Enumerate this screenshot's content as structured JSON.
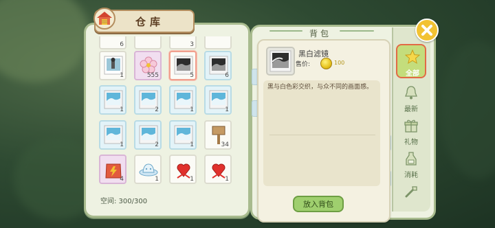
{
  "warehouse": {
    "title": "仓库",
    "capacity_text": "空间: 300/300",
    "slots": [
      {
        "item": "card-top",
        "count": "6",
        "style": "white"
      },
      {
        "item": "card-top",
        "count": "",
        "style": "white"
      },
      {
        "item": "card-top",
        "count": "3",
        "style": "white"
      },
      {
        "item": "card-top",
        "count": "",
        "style": "white"
      },
      {
        "item": "postcard-figure",
        "count": "1",
        "style": "white"
      },
      {
        "item": "cherry-blossom",
        "count": "555",
        "style": "purple"
      },
      {
        "item": "photo-bw",
        "count": "5",
        "style": "white",
        "selected": true
      },
      {
        "item": "photo-bw",
        "count": "6",
        "style": "blue"
      },
      {
        "item": "photo-sky",
        "count": "1",
        "style": "blue"
      },
      {
        "item": "photo-sky",
        "count": "2",
        "style": "blue"
      },
      {
        "item": "photo-sky",
        "count": "1",
        "style": "blue"
      },
      {
        "item": "photo-sky",
        "count": "1",
        "style": "blue"
      },
      {
        "item": "photo-sky",
        "count": "1",
        "style": "blue"
      },
      {
        "item": "photo-sky",
        "count": "2",
        "style": "blue"
      },
      {
        "item": "photo-sky",
        "count": "1",
        "style": "blue"
      },
      {
        "item": "wooden-sign",
        "count": "34",
        "style": "white"
      },
      {
        "item": "red-bag",
        "count": "4",
        "style": "purple"
      },
      {
        "item": "blue-hat",
        "count": "1",
        "style": "white"
      },
      {
        "item": "heart-bow",
        "count": "1",
        "style": "white"
      },
      {
        "item": "heart-bow",
        "count": "1",
        "style": "white"
      }
    ]
  },
  "bag": {
    "title": "背包",
    "item_name": "黑白滤镜",
    "price_label": "售价:",
    "price_value": "100",
    "description": "黑与白色彩交织，与众不同的画面感。",
    "put_button": "放入背包"
  },
  "tabs": [
    {
      "label": "全部",
      "icon": "star-icon",
      "active": true
    },
    {
      "label": "最新",
      "icon": "bell-icon",
      "active": false
    },
    {
      "label": "礼物",
      "icon": "gift-icon",
      "active": false
    },
    {
      "label": "消耗",
      "icon": "bottle-icon",
      "active": false
    },
    {
      "label": "",
      "icon": "tool-icon",
      "active": false
    }
  ],
  "colors": {
    "panel": "#eef2e2",
    "accent_green": "#9fcf6e",
    "active_tab_outline": "#e26a45",
    "close_button": "#f2c233"
  }
}
